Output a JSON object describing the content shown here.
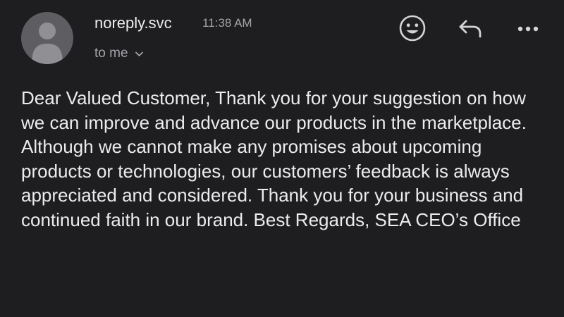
{
  "email": {
    "sender": "noreply.svc",
    "time": "11:38 AM",
    "recipient_label": "to me",
    "body": "Dear Valued Customer, Thank you for your suggestion on how we can improve and advance our products in the marketplace. Although we cannot make any promises about upcoming products or technologies, our customers’ feedback is always appreciated and considered. Thank you for your business and continued faith in our brand. Best Regards, SEA CEO’s Office"
  },
  "icons": {
    "avatar": "person-avatar-icon",
    "recipient_toggle": "chevron-down-icon",
    "react": "smiley-face-icon",
    "reply": "reply-arrow-icon",
    "more": "more-horizontal-icon"
  },
  "colors": {
    "background": "#1e1e20",
    "primary_text": "#ececee",
    "secondary_text": "#a3a3a8",
    "avatar_bg": "#5d5d62",
    "avatar_fg": "#8f8f94"
  }
}
